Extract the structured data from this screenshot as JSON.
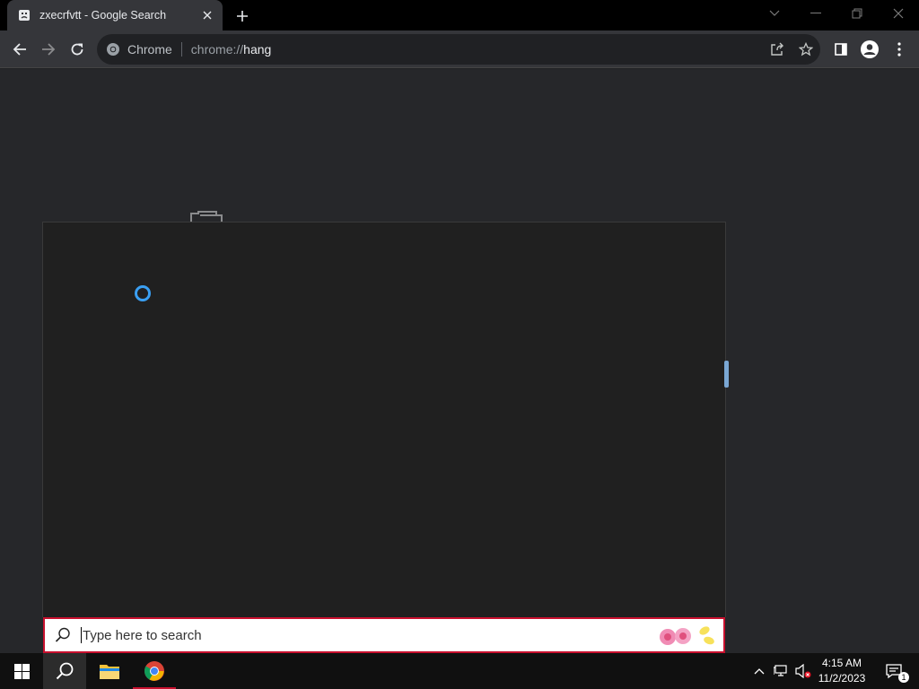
{
  "browser": {
    "tab": {
      "title": "zxecrfvtt - Google Search"
    },
    "omnibox": {
      "chip": "Chrome",
      "url_prefix": "chrome://",
      "url_host": "hang"
    }
  },
  "search": {
    "placeholder": "Type here to search"
  },
  "taskbar": {
    "time": "4:15 AM",
    "date": "11/2/2023",
    "notification_count": "1"
  },
  "colors": {
    "accent": "#c8102e",
    "spinner": "#3a9ff2"
  },
  "icons": [
    "sad-tab-icon",
    "close-icon",
    "plus-icon",
    "chevron-down-icon",
    "minimize-icon",
    "restore-icon",
    "window-close-icon",
    "back-icon",
    "forward-icon",
    "reload-icon",
    "chrome-icon",
    "share-icon",
    "star-icon",
    "side-panel-icon",
    "profile-icon",
    "kebab-menu-icon",
    "search-icon",
    "windows-logo-icon",
    "file-explorer-icon",
    "chrome-taskbar-icon",
    "chevron-up-icon",
    "network-icon",
    "volume-muted-icon",
    "notification-icon"
  ]
}
